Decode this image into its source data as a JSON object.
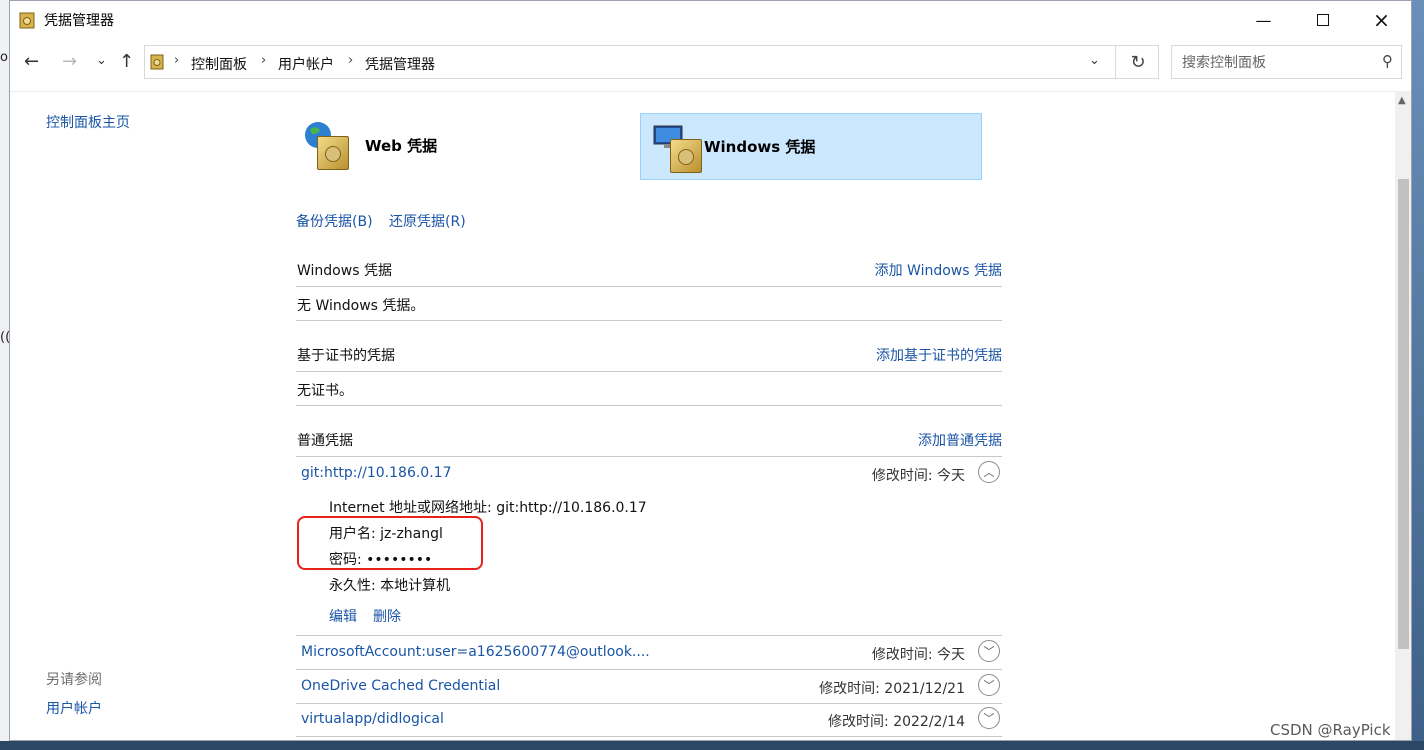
{
  "window": {
    "title": "凭据管理器"
  },
  "desktop": {
    "left_edge_texts": [
      "o",
      "(("
    ]
  },
  "nav": {
    "back": "←",
    "forward": "→",
    "recent": "⌄",
    "up": "↑",
    "breadcrumb": [
      "控制面板",
      "用户帐户",
      "凭据管理器"
    ],
    "separator": "›",
    "search_placeholder": "搜索控制面板"
  },
  "left": {
    "home": "控制面板主页",
    "see_also": "另请参阅",
    "user_accounts": "用户帐户"
  },
  "tabs": {
    "web": "Web 凭据",
    "windows": "Windows 凭据"
  },
  "actions": {
    "backup": "备份凭据(B)",
    "restore": "还原凭据(R)"
  },
  "sections": {
    "windows": {
      "title": "Windows 凭据",
      "add": "添加 Windows 凭据",
      "empty": "无 Windows 凭据。"
    },
    "cert": {
      "title": "基于证书的凭据",
      "add": "添加基于证书的凭据",
      "empty": "无证书。"
    },
    "generic": {
      "title": "普通凭据",
      "add": "添加普通凭据"
    }
  },
  "credentials": [
    {
      "name": "git:http://10.186.0.17",
      "time": "修改时间: 今天",
      "expanded": true
    },
    {
      "name": "MicrosoftAccount:user=a1625600774@outlook....",
      "time": "修改时间: 今天"
    },
    {
      "name": "OneDrive Cached Credential",
      "time": "修改时间: 2021/12/21"
    },
    {
      "name": "virtualapp/didlogical",
      "time": "修改时间: 2022/2/14"
    }
  ],
  "detail": {
    "address": "Internet 地址或网络地址: git:http://10.186.0.17",
    "username": "用户名: jz-zhangl",
    "password": "密码: ••••••••",
    "persistence": "永久性: 本地计算机",
    "edit": "编辑",
    "delete": "删除"
  },
  "watermark": "CSDN @RayPick"
}
